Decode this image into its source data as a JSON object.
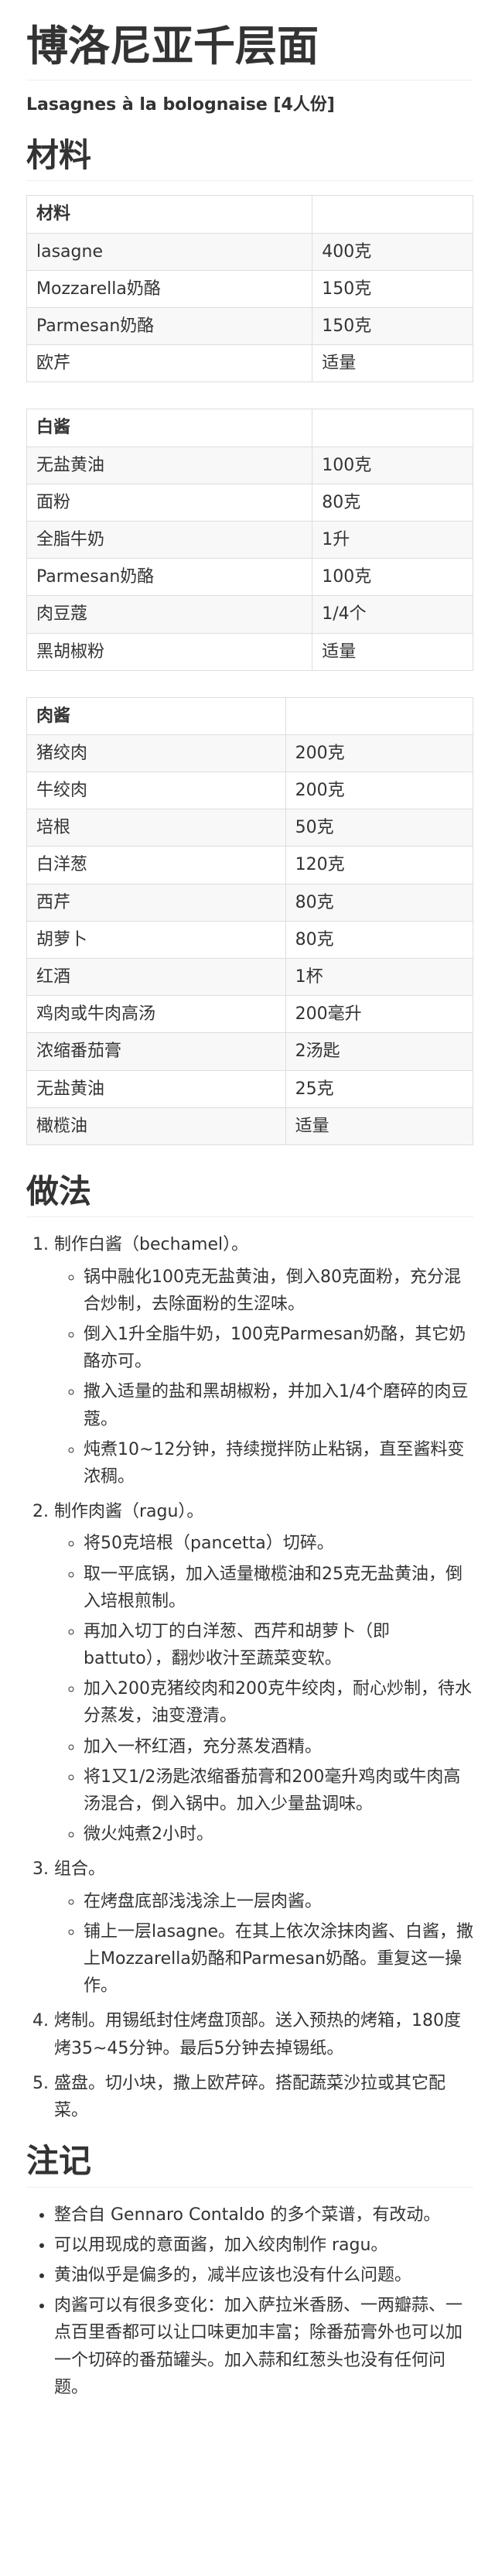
{
  "title": "博洛尼亚千层面",
  "subtitle": "Lasagnes à la bolognaise [4人份]",
  "sections": {
    "materials": "材料",
    "method": "做法",
    "notes": "注记"
  },
  "tables": [
    {
      "header": [
        "材料",
        ""
      ],
      "rows": [
        [
          "lasagne",
          "400克"
        ],
        [
          "Mozzarella奶酪",
          "150克"
        ],
        [
          "Parmesan奶酪",
          "150克"
        ],
        [
          "欧芹",
          "适量"
        ]
      ]
    },
    {
      "header": [
        "白酱",
        ""
      ],
      "rows": [
        [
          "无盐黄油",
          "100克"
        ],
        [
          "面粉",
          "80克"
        ],
        [
          "全脂牛奶",
          "1升"
        ],
        [
          "Parmesan奶酪",
          "100克"
        ],
        [
          "肉豆蔻",
          "1/4个"
        ],
        [
          "黑胡椒粉",
          "适量"
        ]
      ]
    },
    {
      "header": [
        "肉酱",
        ""
      ],
      "rows": [
        [
          "猪绞肉",
          "200克"
        ],
        [
          "牛绞肉",
          "200克"
        ],
        [
          "培根",
          "50克"
        ],
        [
          "白洋葱",
          "120克"
        ],
        [
          "西芹",
          "80克"
        ],
        [
          "胡萝卜",
          "80克"
        ],
        [
          "红酒",
          "1杯"
        ],
        [
          "鸡肉或牛肉高汤",
          "200毫升"
        ],
        [
          "浓缩番茄膏",
          "2汤匙"
        ],
        [
          "无盐黄油",
          "25克"
        ],
        [
          "橄榄油",
          "适量"
        ]
      ]
    }
  ],
  "steps": [
    {
      "text": "制作白酱（bechamel）。",
      "sub": [
        "锅中融化100克无盐黄油，倒入80克面粉，充分混合炒制，去除面粉的生涩味。",
        "倒入1升全脂牛奶，100克Parmesan奶酪，其它奶酪亦可。",
        "撒入适量的盐和黑胡椒粉，并加入1/4个磨碎的肉豆蔻。",
        "炖煮10~12分钟，持续搅拌防止粘锅，直至酱料变浓稠。"
      ]
    },
    {
      "text": "制作肉酱（ragu）。",
      "sub": [
        "将50克培根（pancetta）切碎。",
        "取一平底锅，加入适量橄榄油和25克无盐黄油，倒入培根煎制。",
        "再加入切丁的白洋葱、西芹和胡萝卜（即battuto），翻炒收汁至蔬菜变软。",
        "加入200克猪绞肉和200克牛绞肉，耐心炒制，待水分蒸发，油变澄清。",
        "加入一杯红酒，充分蒸发酒精。",
        "将1又1/2汤匙浓缩番茄膏和200毫升鸡肉或牛肉高汤混合，倒入锅中。加入少量盐调味。",
        "微火炖煮2小时。"
      ]
    },
    {
      "text": "组合。",
      "sub": [
        "在烤盘底部浅浅涂上一层肉酱。",
        "铺上一层lasagne。在其上依次涂抹肉酱、白酱，撒上Mozzarella奶酪和Parmesan奶酪。重复这一操作。"
      ]
    },
    {
      "text": "烤制。用锡纸封住烤盘顶部。送入预热的烤箱，180度烤35~45分钟。最后5分钟去掉锡纸。",
      "sub": []
    },
    {
      "text": "盛盘。切小块，撒上欧芹碎。搭配蔬菜沙拉或其它配菜。",
      "sub": []
    }
  ],
  "notes": [
    "整合自 Gennaro Contaldo 的多个菜谱，有改动。",
    "可以用现成的意面酱，加入绞肉制作 ragu。",
    "黄油似乎是偏多的，减半应该也没有什么问题。",
    "肉酱可以有很多变化：加入萨拉米香肠、一两瓣蒜、一点百里香都可以让口味更加丰富；除番茄膏外也可以加一个切碎的番茄罐头。加入蒜和红葱头也没有任何问题。"
  ]
}
